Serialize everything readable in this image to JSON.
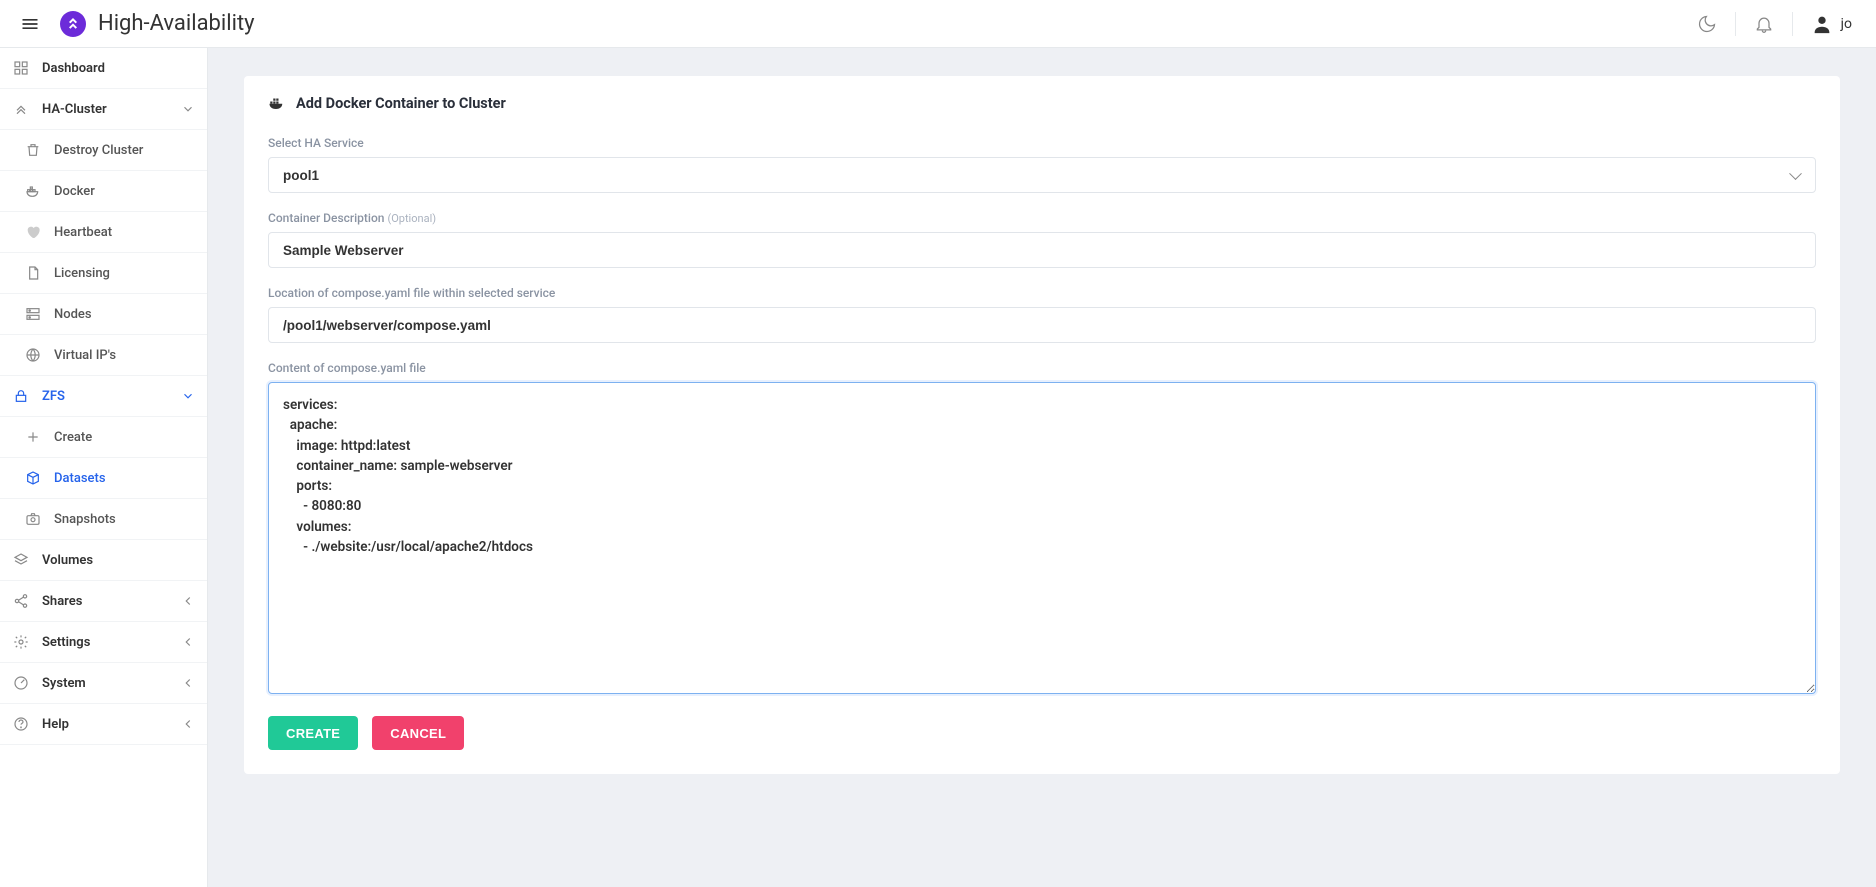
{
  "header": {
    "title": "High-Availability",
    "user": "jo"
  },
  "sidebar": {
    "dashboard": "Dashboard",
    "hacluster": "HA-Cluster",
    "ha_items": {
      "destroy": "Destroy Cluster",
      "docker": "Docker",
      "heartbeat": "Heartbeat",
      "licensing": "Licensing",
      "nodes": "Nodes",
      "vips": "Virtual IP's"
    },
    "zfs": "ZFS",
    "zfs_items": {
      "create": "Create",
      "datasets": "Datasets",
      "snapshots": "Snapshots"
    },
    "volumes": "Volumes",
    "shares": "Shares",
    "settings": "Settings",
    "system": "System",
    "help": "Help"
  },
  "card": {
    "title": "Add Docker Container to Cluster"
  },
  "form": {
    "service_label": "Select HA Service",
    "service_value": "pool1",
    "desc_label": "Container Description",
    "desc_optional": "(Optional)",
    "desc_value": "Sample Webserver",
    "location_label": "Location of compose.yaml file within selected service",
    "location_value": "/pool1/webserver/compose.yaml",
    "content_label": "Content of compose.yaml file",
    "content_value": "services:\n  apache:\n    image: httpd:latest\n    container_name: sample-webserver\n    ports:\n      - 8080:80\n    volumes:\n      - ./website:/usr/local/apache2/htdocs",
    "create_btn": "CREATE",
    "cancel_btn": "CANCEL"
  }
}
